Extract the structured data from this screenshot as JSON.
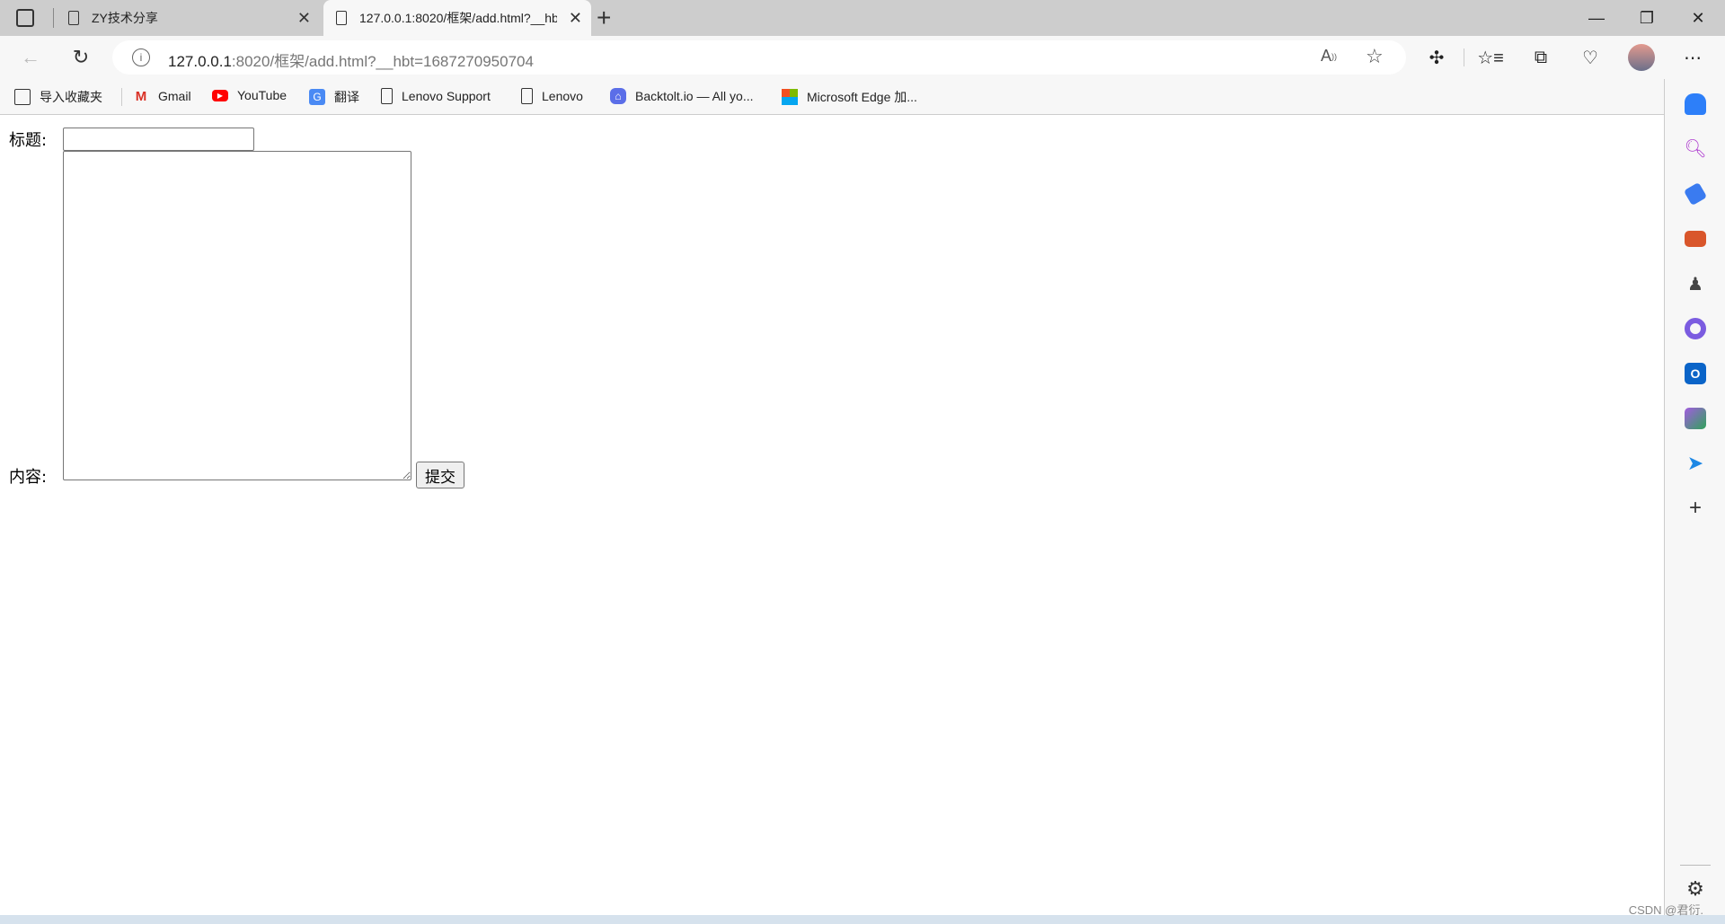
{
  "tabs": [
    {
      "title": "ZY技术分享",
      "icon": "page-icon"
    },
    {
      "title": "127.0.0.1:8020/框架/add.html?__hbt=1687270950704",
      "icon": "page-icon",
      "active": true
    }
  ],
  "address": {
    "host": "127.0.0.1",
    "rest": ":8020/框架/add.html?__hbt=1687270950704"
  },
  "bookmarks": [
    {
      "label": "导入收藏夹",
      "icon": "import-folder-icon"
    },
    {
      "label": "Gmail",
      "icon": "gmail-icon"
    },
    {
      "label": "YouTube",
      "icon": "youtube-icon"
    },
    {
      "label": "翻译",
      "icon": "translate-icon"
    },
    {
      "label": "Lenovo Support",
      "icon": "page-icon"
    },
    {
      "label": "Lenovo",
      "icon": "page-icon"
    },
    {
      "label": "Backtolt.io — All yo...",
      "icon": "backtolt-icon"
    },
    {
      "label": "Microsoft Edge 加...",
      "icon": "microsoft-icon"
    }
  ],
  "form": {
    "title_label": "标题:",
    "content_label": "内容:",
    "title_value": "",
    "content_value": "",
    "submit_label": "提交"
  },
  "watermark": "CSDN @君衍."
}
